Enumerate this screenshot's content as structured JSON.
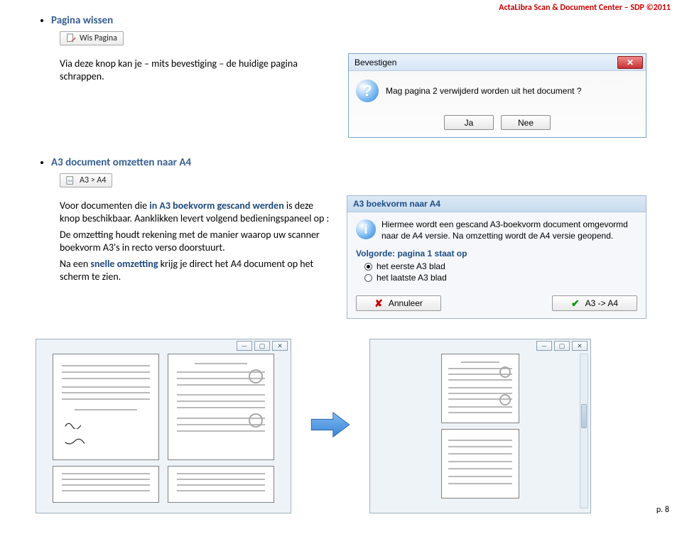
{
  "header": "ActaLibra Scan & Document Center – SDP ©2011",
  "section1": {
    "title": "Pagina wissen",
    "btn_label": "Wis Pagina",
    "desc": "Via deze knop kan je – mits bevestiging – de huidige pagina schrappen."
  },
  "dialog": {
    "title": "Bevestigen",
    "message": "Mag pagina 2 verwijderd worden uit het document ?",
    "yes": "Ja",
    "no": "Nee"
  },
  "section2": {
    "title": "A3 document omzetten naar A4",
    "btn_label": "A3 > A4",
    "p1_pre": "Voor documenten die ",
    "p1_blue": "in A3 boekvorm gescand werden",
    "p1_post": " is deze knop beschikbaar. Aanklikken levert volgend bedieningspaneel op :",
    "p2": "De omzetting houdt rekening met de manier waarop uw scanner boekvorm A3's in recto verso doorstuurt.",
    "p3_pre": "Na een ",
    "p3_blue": "snelle omzetting",
    "p3_post": " krijg je direct het A4 document op het scherm te zien."
  },
  "panel": {
    "header": "A3 boekvorm naar A4",
    "infotext": "Hiermee wordt een gescand A3-boekvorm document omgevormd naar de A4 versie. Na omzetting wordt de A4 versie geopend.",
    "volgorde": "Volgorde: pagina 1 staat op",
    "opt1": "het eerste A3 blad",
    "opt2": "het laatste A3 blad",
    "btn_cancel": "Annuleer",
    "btn_go": "A3 -> A4"
  },
  "pagenum": "p. 8"
}
